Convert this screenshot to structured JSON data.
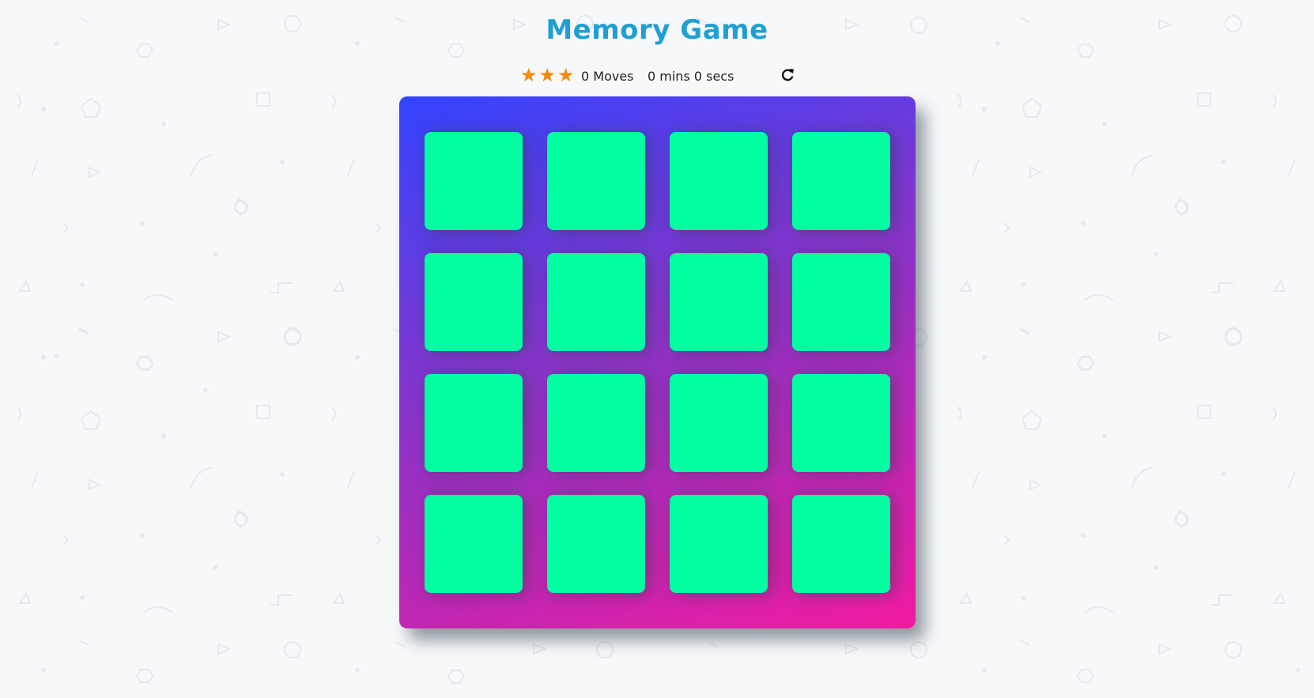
{
  "header": {
    "title": "Memory Game"
  },
  "score_panel": {
    "stars": [
      "star-icon",
      "star-icon",
      "star-icon"
    ],
    "star_color": "#f58a07",
    "moves_text": "0 Moves",
    "timer_text": "0 mins 0 secs",
    "restart_icon": "repeat-icon"
  },
  "deck": {
    "rows": 4,
    "cols": 4,
    "card_color": "#02ffa2",
    "gradient_colors": [
      "#3344ff",
      "#8a34c9",
      "#f21aa0"
    ],
    "card_state": "face-down"
  },
  "colors": {
    "title": "#1ea0d4",
    "background": "#f7f8fa"
  }
}
